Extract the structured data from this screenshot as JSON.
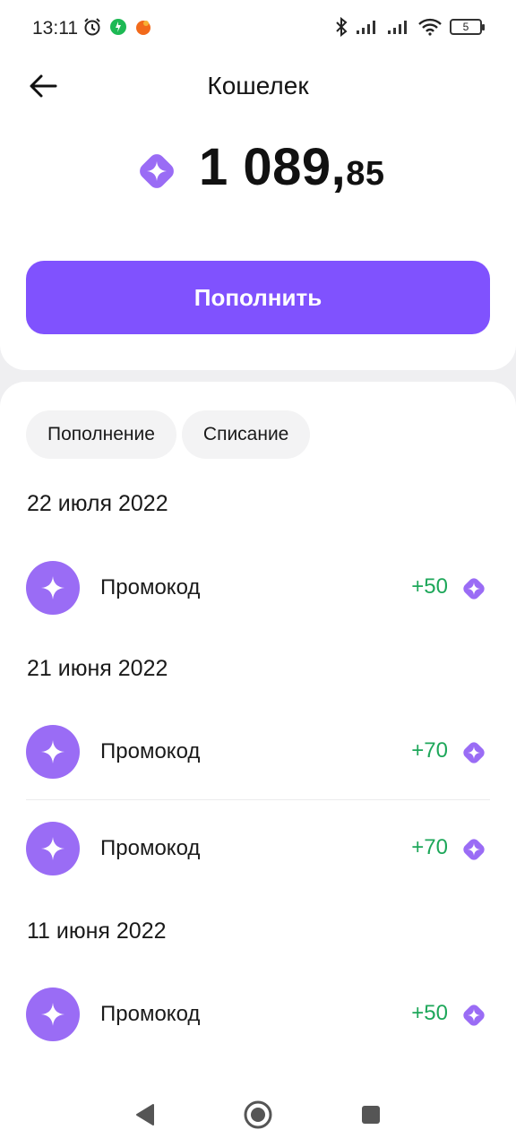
{
  "status_bar": {
    "time": "13:11",
    "battery": "5",
    "icons": [
      "alarm-icon",
      "app-notification-icon",
      "app-notification-icon",
      "bluetooth-icon",
      "signal-icon",
      "signal-icon",
      "wifi-icon",
      "battery-icon"
    ]
  },
  "header": {
    "title": "Кошелек",
    "back_icon": "arrow-left-icon"
  },
  "balance": {
    "whole": "1 089,",
    "cents": "85",
    "currency_icon": "star-coin-icon"
  },
  "topup_button": {
    "label": "Пополнить"
  },
  "filters": [
    {
      "label": "Пополнение"
    },
    {
      "label": "Списание"
    }
  ],
  "history": [
    {
      "date": "22 июля 2022",
      "items": [
        {
          "label": "Промокод",
          "amount": "+50"
        }
      ]
    },
    {
      "date": "21 июня 2022",
      "items": [
        {
          "label": "Промокод",
          "amount": "+70"
        },
        {
          "label": "Промокод",
          "amount": "+70"
        }
      ]
    },
    {
      "date": "11 июня 2022",
      "items": [
        {
          "label": "Промокод",
          "amount": "+50"
        }
      ]
    }
  ],
  "colors": {
    "accent": "#8052fe",
    "avatar": "#9a6cf5",
    "positive": "#1ea75a",
    "background": "#efeff1"
  },
  "nav_bar": {
    "icons": [
      "back-triangle-icon",
      "home-circle-icon",
      "recents-square-icon"
    ]
  }
}
